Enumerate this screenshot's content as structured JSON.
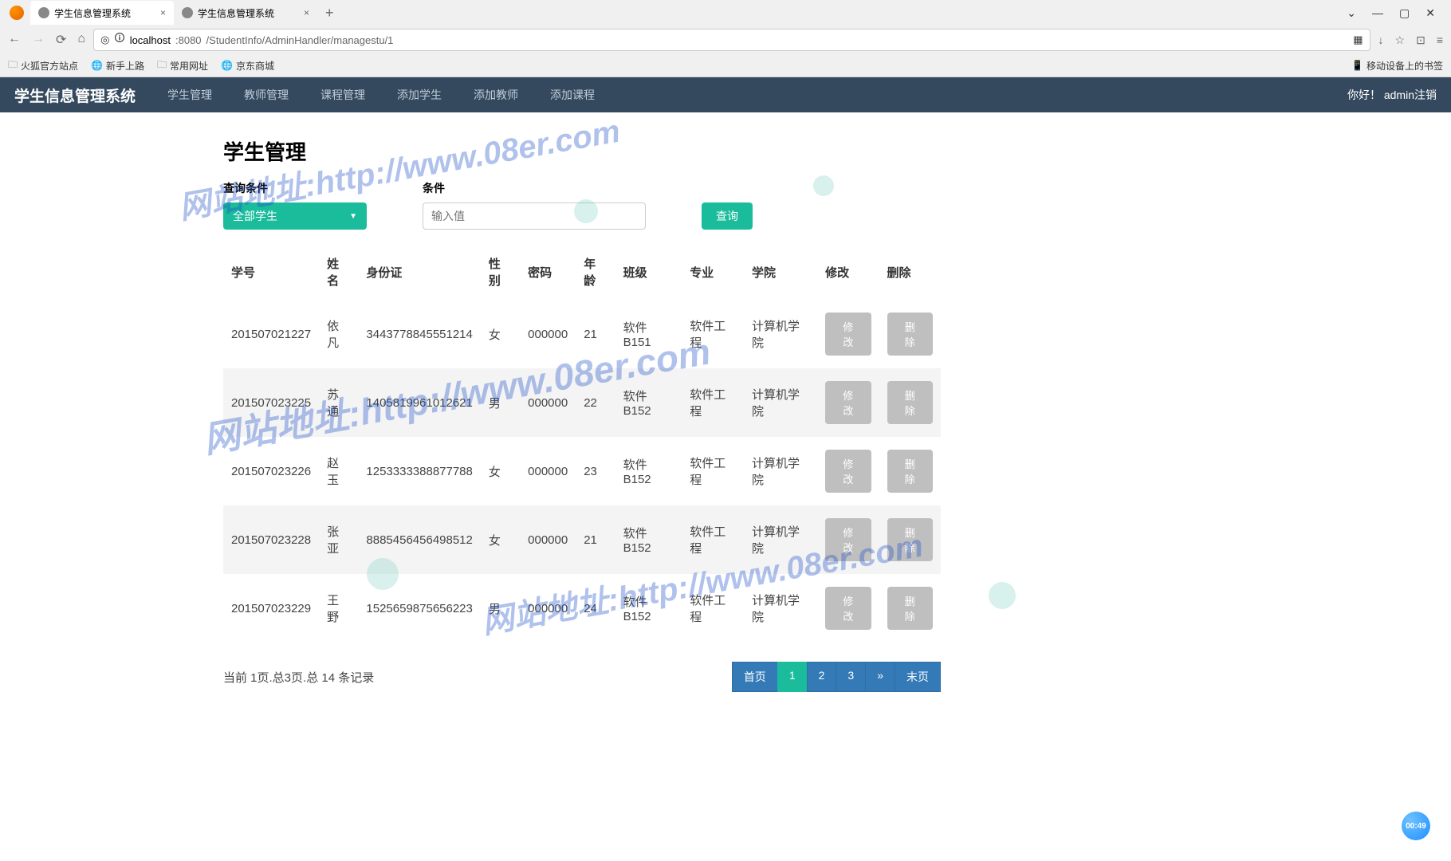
{
  "browser": {
    "tabs": [
      {
        "title": "学生信息管理系统",
        "active": true
      },
      {
        "title": "学生信息管理系统",
        "active": false
      }
    ],
    "url_host": "localhost",
    "url_port": ":8080",
    "url_path": "/StudentInfo/AdminHandler/managestu/1",
    "bookmarks": [
      "火狐官方站点",
      "新手上路",
      "常用网址",
      "京东商城"
    ],
    "mobile_sync": "移动设备上的书签"
  },
  "nav": {
    "brand": "学生信息管理系统",
    "items": [
      "学生管理",
      "教师管理",
      "课程管理",
      "添加学生",
      "添加教师",
      "添加课程"
    ],
    "greeting": "你好！",
    "user": "admin",
    "logout": "注销"
  },
  "page": {
    "title": "学生管理",
    "query_label": "查询条件",
    "dropdown_value": "全部学生",
    "cond_label": "条件",
    "input_placeholder": "输入值",
    "query_btn": "查询"
  },
  "table": {
    "headers": [
      "学号",
      "姓名",
      "身份证",
      "性别",
      "密码",
      "年龄",
      "班级",
      "专业",
      "学院",
      "修改",
      "删除"
    ],
    "edit_label": "修改",
    "delete_label": "删除",
    "rows": [
      {
        "id": "201507021227",
        "name": "依凡",
        "idcard": "3443778845551214",
        "gender": "女",
        "pwd": "000000",
        "age": "21",
        "class": "软件B151",
        "major": "软件工程",
        "college": "计算机学院"
      },
      {
        "id": "201507023225",
        "name": "苏通",
        "idcard": "1405819961012621",
        "gender": "男",
        "pwd": "000000",
        "age": "22",
        "class": "软件B152",
        "major": "软件工程",
        "college": "计算机学院"
      },
      {
        "id": "201507023226",
        "name": "赵玉",
        "idcard": "1253333388877788",
        "gender": "女",
        "pwd": "000000",
        "age": "23",
        "class": "软件B152",
        "major": "软件工程",
        "college": "计算机学院"
      },
      {
        "id": "201507023228",
        "name": "张亚",
        "idcard": "8885456456498512",
        "gender": "女",
        "pwd": "000000",
        "age": "21",
        "class": "软件B152",
        "major": "软件工程",
        "college": "计算机学院"
      },
      {
        "id": "201507023229",
        "name": "王野",
        "idcard": "1525659875656223",
        "gender": "男",
        "pwd": "000000",
        "age": "24",
        "class": "软件B152",
        "major": "软件工程",
        "college": "计算机学院"
      }
    ]
  },
  "pagination": {
    "summary": "当前 1页.总3页.总 14 条记录",
    "first": "首页",
    "pages": [
      "1",
      "2",
      "3"
    ],
    "next": "»",
    "last": "末页",
    "active_index": 0
  },
  "watermark": "网站地址:http://www.08er.com",
  "recording": "00:49"
}
